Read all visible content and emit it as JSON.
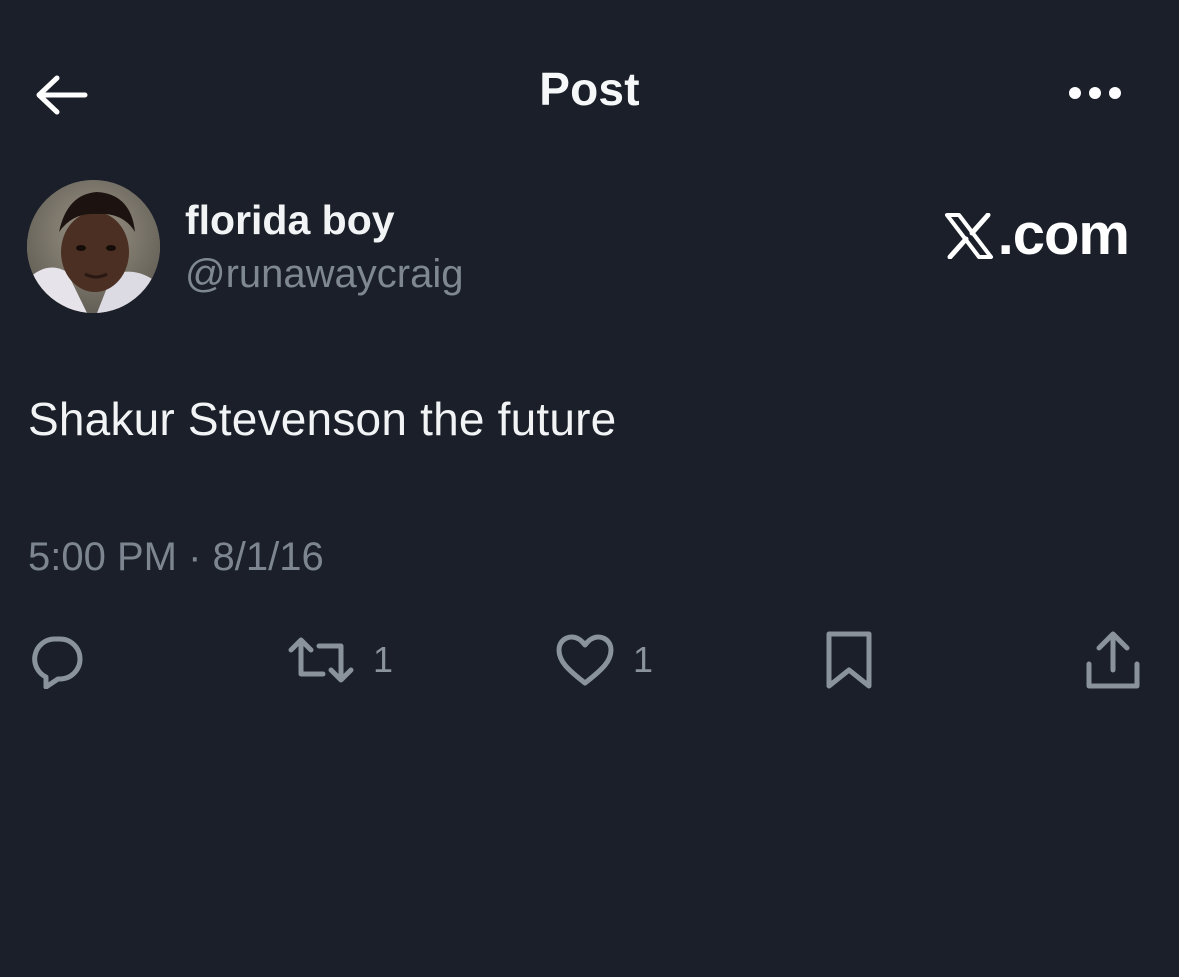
{
  "header": {
    "title": "Post",
    "back_icon": "arrow-left-icon",
    "more_icon": "more-horizontal-icon"
  },
  "author": {
    "name": "florida boy",
    "handle": "@runawaycraig"
  },
  "watermark": {
    "text": ".com"
  },
  "post": {
    "text": "Shakur Stevenson the future",
    "timestamp": "5:00 PM · 8/1/16"
  },
  "actions": {
    "reply_icon": "reply-icon",
    "repost_icon": "repost-icon",
    "repost_count": "1",
    "like_icon": "heart-icon",
    "like_count": "1",
    "bookmark_icon": "bookmark-icon",
    "share_icon": "share-icon"
  },
  "colors": {
    "background": "#1a1f29",
    "primary_text": "#e7e9ea",
    "secondary_text": "#7d8590"
  }
}
